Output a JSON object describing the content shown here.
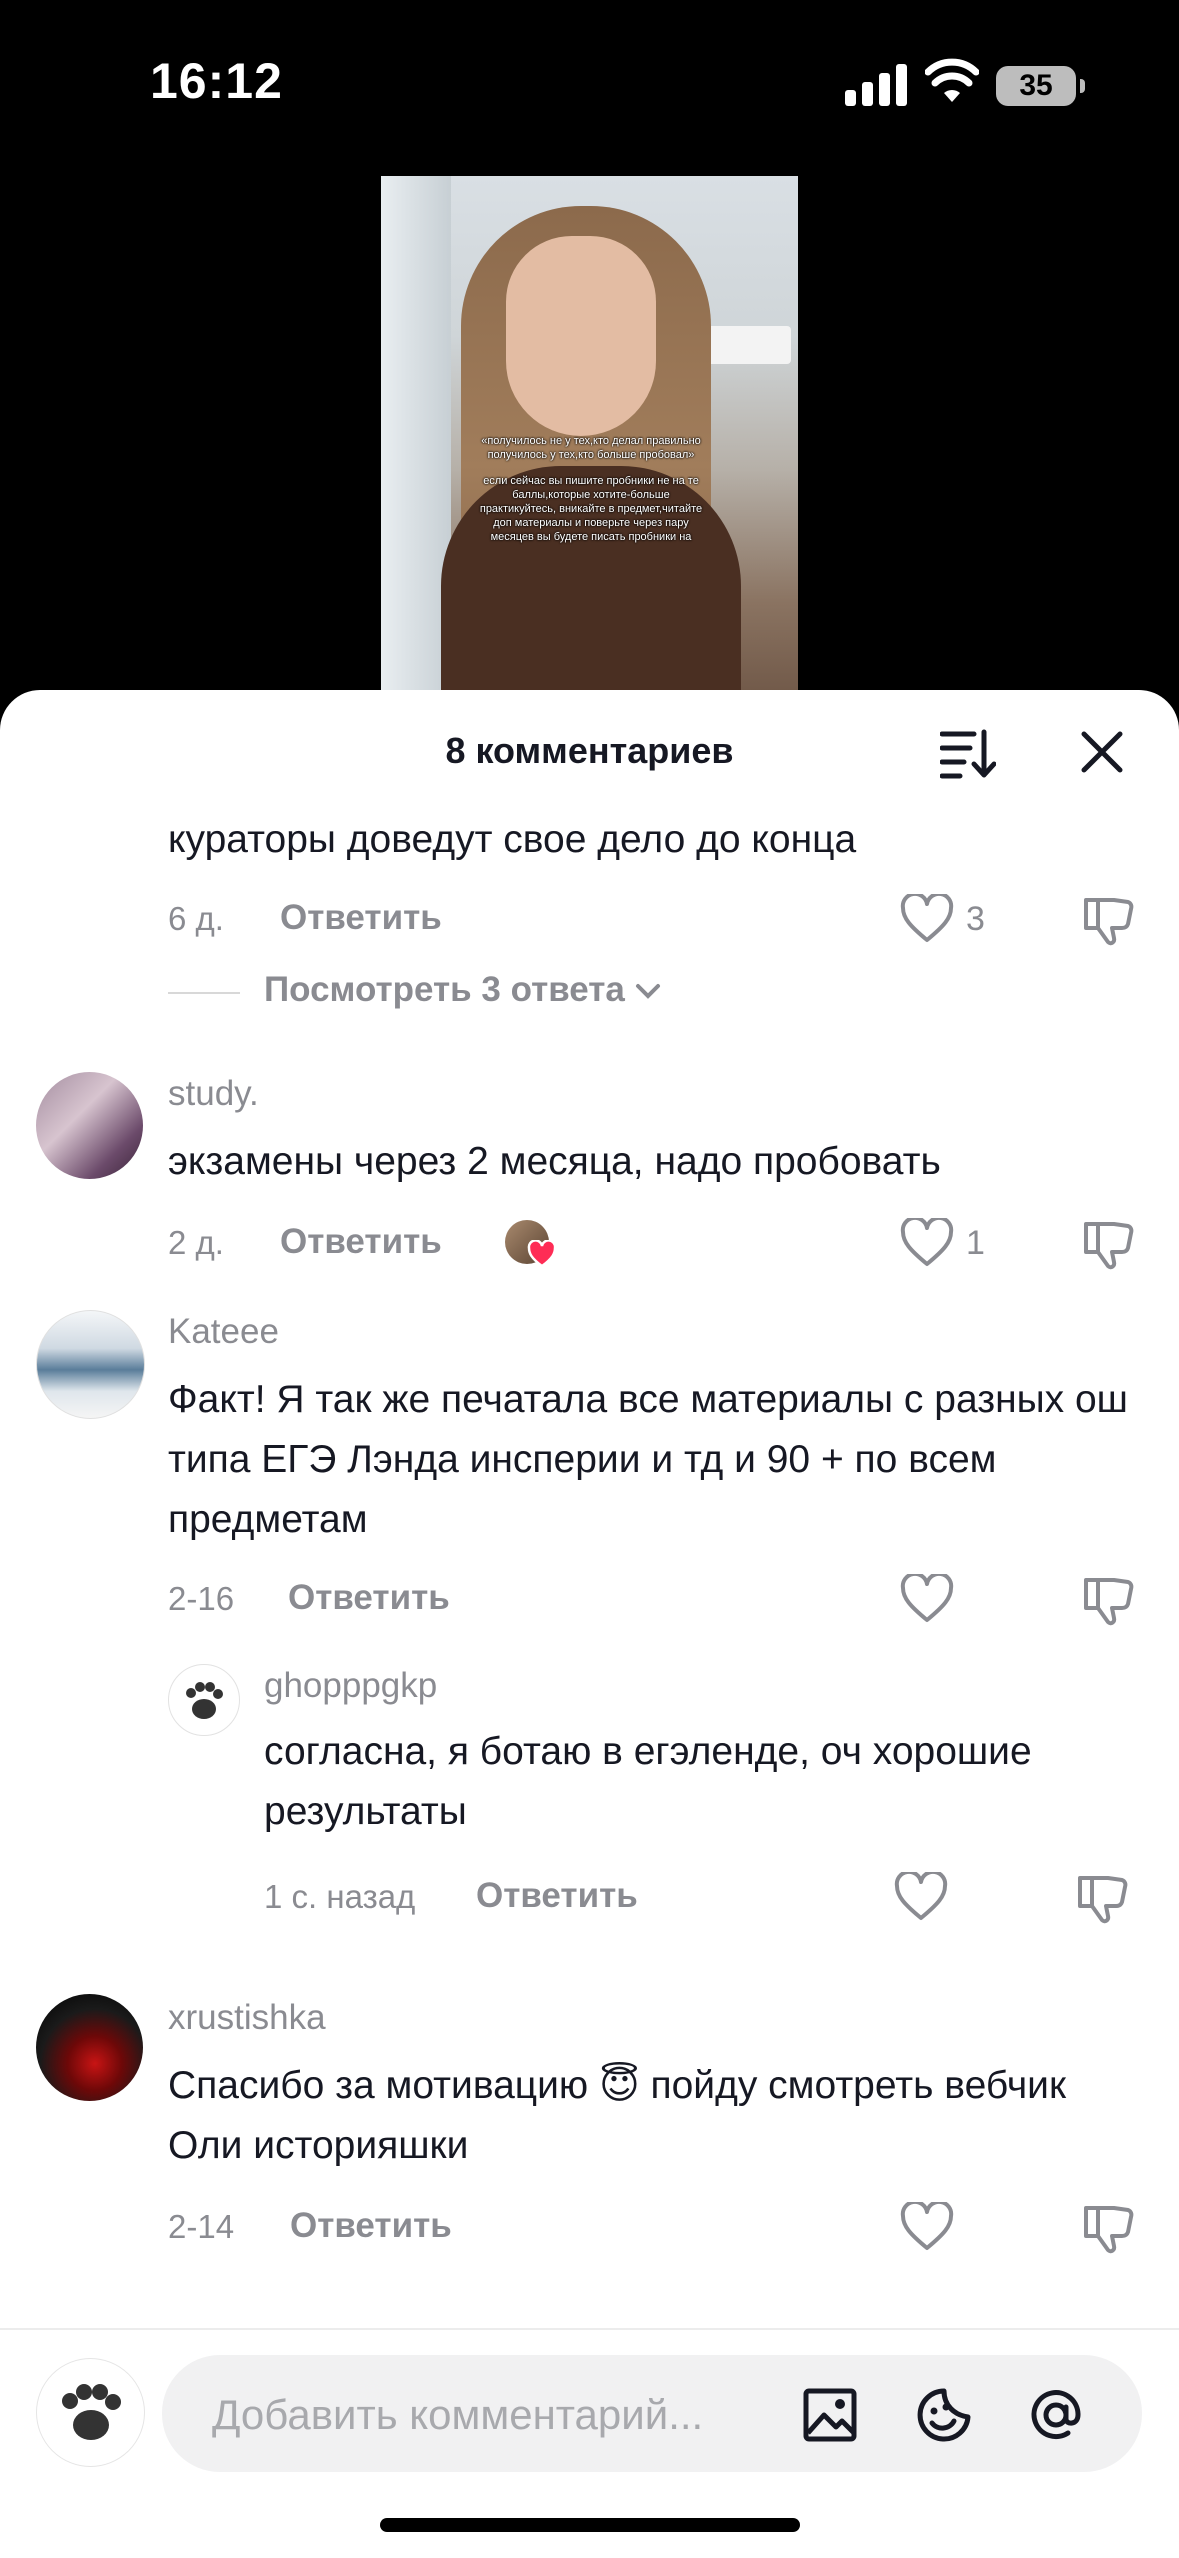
{
  "status_bar": {
    "time": "16:12",
    "battery": "35"
  },
  "video": {
    "caption_quote": "«получилось не у тех,кто делал правильно получилось у тех,кто больше пробовал»",
    "caption_body": "если сейчас вы пишите пробники не на те баллы,которые хотите-больше практикуйтесь, вникайте в предмет,читайте доп материалы и поверьте через пару месяцев вы будете писать пробники на"
  },
  "sheet": {
    "title": "8 комментариев"
  },
  "comments": [
    {
      "text": "кураторы доведут свое дело до конца",
      "date": "6 д.",
      "reply": "Ответить",
      "likes": "3",
      "view_replies": "Посмотреть 3 ответа"
    },
    {
      "user": "study.",
      "text": "экзамены через 2 месяца, надо пробовать",
      "date": "2 д.",
      "reply": "Ответить",
      "likes": "1"
    },
    {
      "user": "Kateee",
      "text": "Факт! Я так же печатала все материалы с разных ош типа ЕГЭ Лэнда инсперии и тд и 90 + по всем предметам",
      "date": "2-16",
      "reply": "Ответить"
    },
    {
      "user": "ghopppgkp",
      "text": "согласна, я ботаю в егэленде, оч хорошие результаты",
      "date": "1 с. назад",
      "reply": "Ответить"
    },
    {
      "user": "xrustishka",
      "text": "Спасибо за мотивацию 😇 пойду смотреть вебчик Оли историяшки",
      "date": "2-14",
      "reply": "Ответить"
    }
  ],
  "input": {
    "placeholder": "Добавить комментарий..."
  },
  "icons": {
    "sort": "sort-icon",
    "close": "close-icon",
    "heart": "heart-icon",
    "dislike": "dislike-icon",
    "image": "image-icon",
    "emoji": "emoji-icon",
    "mention": "at-icon"
  },
  "colors": {
    "text": "#161823",
    "secondary": "#8a8b91",
    "liked_heart": "#fe2c55"
  }
}
